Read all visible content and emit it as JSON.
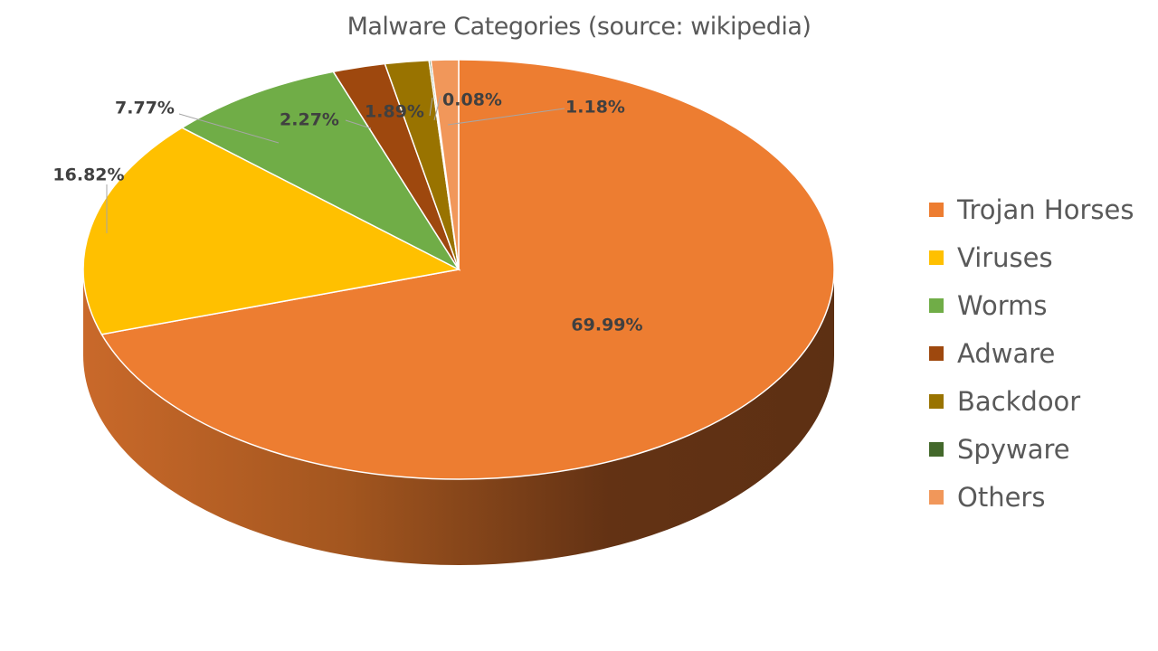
{
  "chart_data": {
    "type": "pie",
    "style": "3d",
    "title": "Malware Categories (source: wikipedia)",
    "legend_position": "right",
    "categories": [
      "Trojan Horses",
      "Viruses",
      "Worms",
      "Adware",
      "Backdoor",
      "Spyware",
      "Others"
    ],
    "values": [
      69.99,
      16.82,
      7.77,
      2.27,
      1.89,
      0.08,
      1.18
    ],
    "labels": [
      "69.99%",
      "16.82%",
      "7.77%",
      "2.27%",
      "1.89%",
      "0.08%",
      "1.18%"
    ],
    "colors": [
      "#ED7D31",
      "#FFC000",
      "#70AD47",
      "#9E480E",
      "#997300",
      "#43682B",
      "#F1975A"
    ],
    "unit": "%"
  }
}
